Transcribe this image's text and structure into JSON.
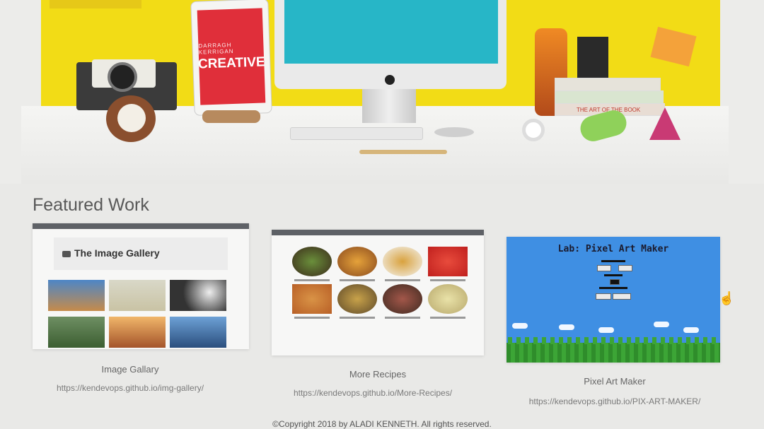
{
  "hero": {
    "tablet_brand": "DARRAGH KERRIGAN",
    "tablet_word": "CREATIVE",
    "book_title": "THE ART OF THE BOOK"
  },
  "featured": {
    "heading": "Featured Work",
    "cards": [
      {
        "title": "Image Gallary",
        "link": "https://kendevops.github.io/img-gallery/",
        "screenshot_title": "The Image Gallery"
      },
      {
        "title": "More Recipes",
        "link": "https://kendevops.github.io/More-Recipes/"
      },
      {
        "title": "Pixel Art Maker",
        "link": "https://kendevops.github.io/PIX-ART-MAKER/",
        "screenshot_title": "Lab: Pixel Art Maker"
      }
    ]
  },
  "footer": {
    "copyright": "©Copyright 2018 by ALADI KENNETH. All rights reserved."
  },
  "colors": {
    "wall": "#f2dc16",
    "tablet": "#e02f3a",
    "imac_screen": "#27b6c7",
    "pixel_sky": "#3f8fe3"
  }
}
